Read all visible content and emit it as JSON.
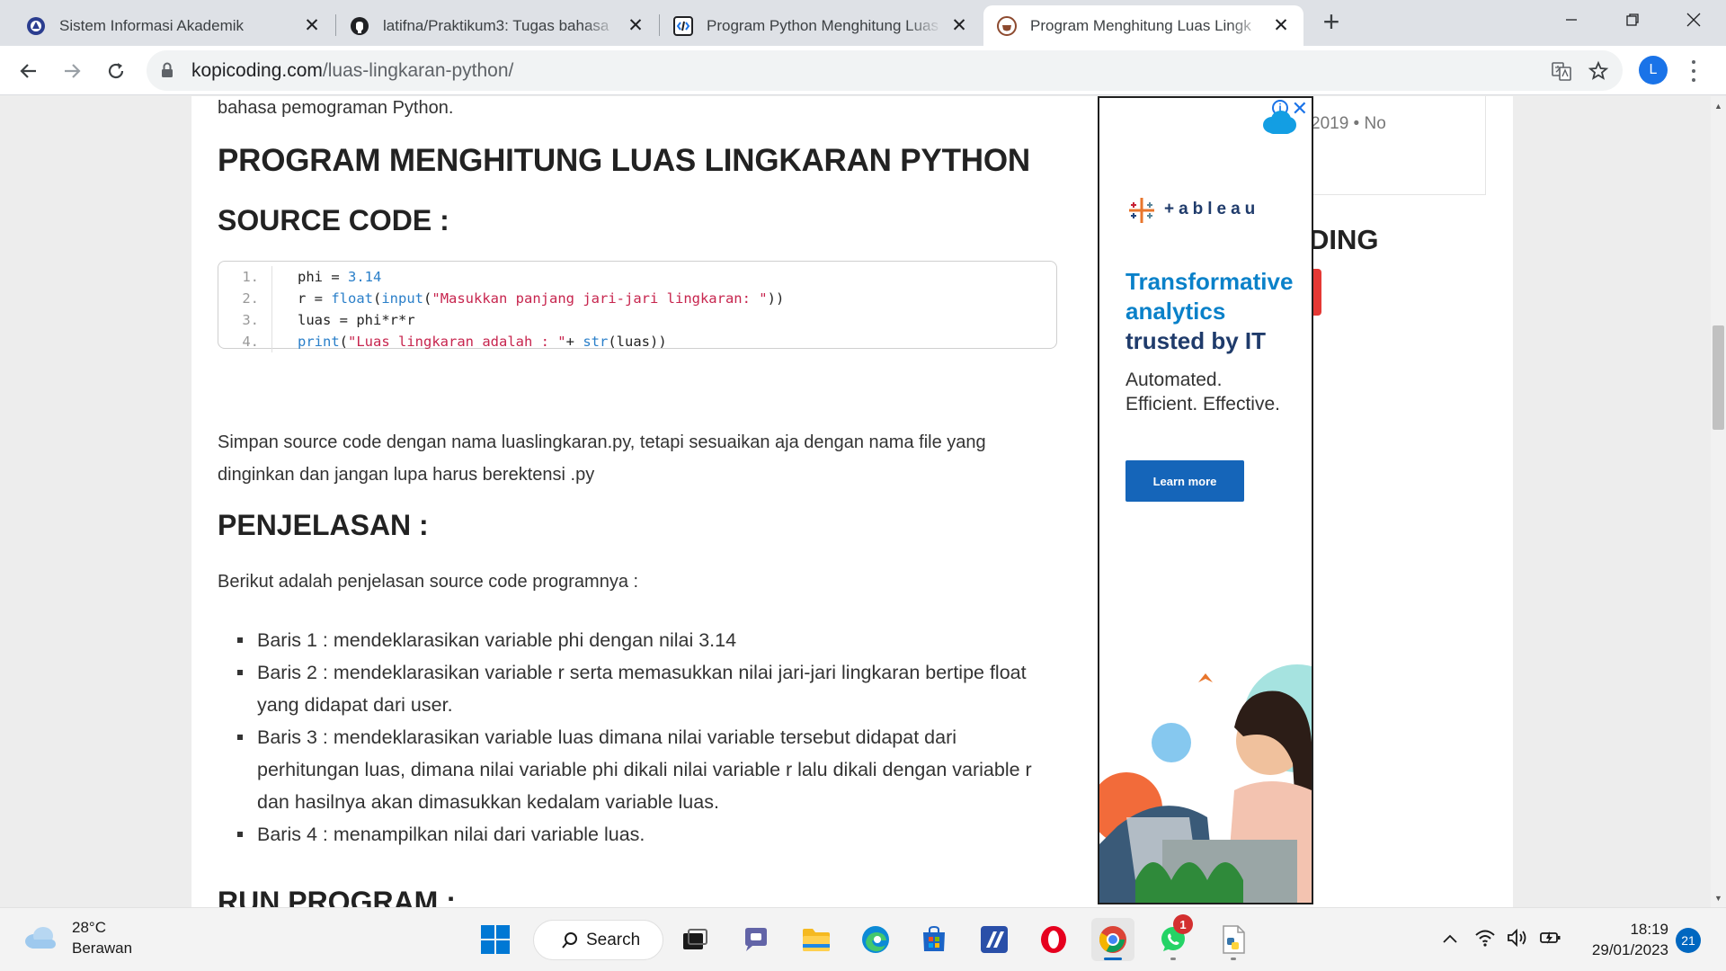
{
  "browser": {
    "tabs": [
      {
        "title": "Sistem Informasi Akademik",
        "favicon": "university-logo-icon"
      },
      {
        "title": "latifna/Praktikum3: Tugas bahasa",
        "favicon": "github-icon"
      },
      {
        "title": "Program Python Menghitung Luas",
        "favicon": "code-brackets-icon"
      },
      {
        "title": "Program Menghitung Luas Lingk",
        "favicon": "kopicoding-icon",
        "active": true
      }
    ],
    "url_host": "kopicoding.com",
    "url_path": "/luas-lingkaran-python/",
    "profile_initial": "L"
  },
  "article": {
    "lead": "bahasa pemograman Python.",
    "title": "PROGRAM MENGHITUNG LUAS LINGKARAN PYTHON",
    "source_heading": "SOURCE CODE :",
    "code_lines": [
      {
        "no": "1.",
        "code": "phi = 3.14"
      },
      {
        "no": "2.",
        "code": "r = float(input(\"Masukkan panjang jari-jari lingkaran: \"))"
      },
      {
        "no": "3.",
        "code": "luas = phi*r*r"
      },
      {
        "no": "4.",
        "code": "print(\"Luas lingkaran adalah : \"+ str(luas))"
      }
    ],
    "save_note": "Simpan source code dengan nama luaslingkaran.py, tetapi sesuaikan aja dengan nama file yang dinginkan dan jangan lupa harus berektensi .py",
    "explain_heading": "PENJELASAN :",
    "explain_intro": "Berikut adalah penjelasan source code programnya :",
    "bullets": [
      "Baris 1 : mendeklarasikan variable phi dengan nilai 3.14",
      "Baris 2 : mendeklarasikan variable r serta memasukkan nilai jari-jari lingkaran bertipe float yang didapat dari user.",
      "Baris 3 : mendeklarasikan variable luas dimana nilai variable tersebut didapat dari perhitungan luas, dimana nilai variable phi dikali nilai variable r lalu dikali dengan variable r dan hasilnya akan dimasukkan kedalam variable luas.",
      "Baris 4 : menampilkan nilai dari variable luas."
    ],
    "run_heading": "RUN PROGRAM :"
  },
  "sidebar": {
    "meta": "2019 • No",
    "heading_fragment": "DING"
  },
  "ad": {
    "brand": "+ableau",
    "headline_blue_1": "Transformative",
    "headline_blue_2": "analytics",
    "headline_dark": "trusted by IT",
    "sub_1": "Automated.",
    "sub_2": "Efficient. Effective.",
    "cta": "Learn more"
  },
  "taskbar": {
    "temperature": "28°C",
    "weather": "Berawan",
    "search_label": "Search",
    "whatsapp_badge": "1",
    "time": "18:19",
    "date": "29/01/2023",
    "notifications": "21"
  },
  "colors": {
    "accent": "#1a73e8",
    "code_keyword": "#2a7fc9",
    "code_string": "#c7254e",
    "ad_button": "#1565b9",
    "sidebar_red": "#e53935"
  }
}
